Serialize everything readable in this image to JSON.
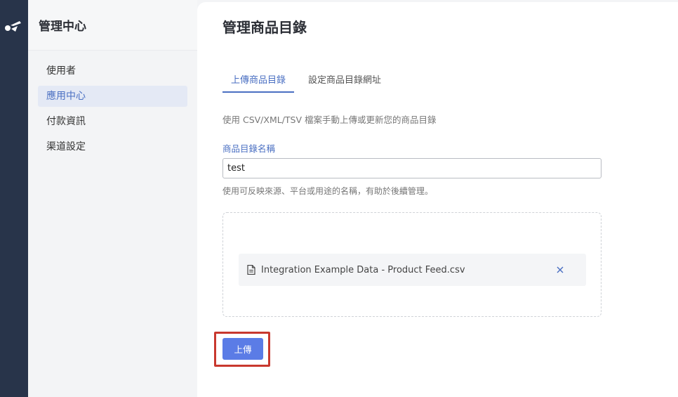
{
  "sidebar": {
    "title": "管理中心",
    "items": [
      {
        "label": "使用者"
      },
      {
        "label": "應用中心"
      },
      {
        "label": "付款資訊"
      },
      {
        "label": "渠道設定"
      }
    ],
    "active_index": 1
  },
  "main": {
    "title": "管理商品目錄",
    "tabs": [
      {
        "label": "上傳商品目錄"
      },
      {
        "label": "設定商品目錄網址"
      }
    ],
    "active_tab": 0,
    "description": "使用 CSV/XML/TSV 檔案手動上傳或更新您的商品目錄",
    "name_field": {
      "label": "商品目錄名稱",
      "value": "test",
      "hint": "使用可反映來源、平台或用途的名稱，有助於後續管理。"
    },
    "upload": {
      "file_name": "Integration Example Data - Product Feed.csv",
      "file_icon": "document-icon",
      "remove_icon": "close-icon"
    },
    "submit_label": "上傳"
  },
  "colors": {
    "rail": "#28344a",
    "accent": "#4a6fc2",
    "button": "#5b7ce6",
    "highlight": "#c8382e"
  }
}
